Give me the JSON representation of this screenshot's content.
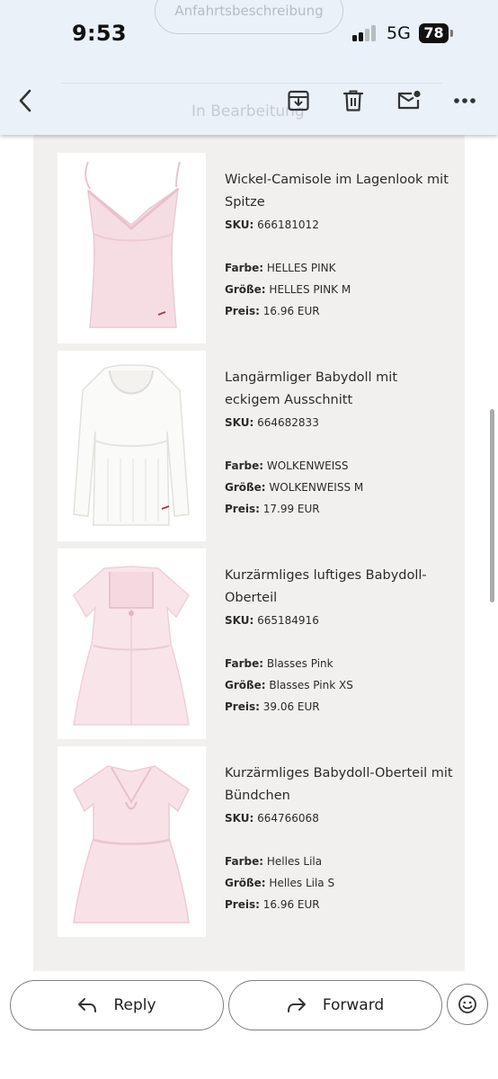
{
  "status_bar": {
    "time": "9:53",
    "network": "5G",
    "battery": "78"
  },
  "faint_overlay": {
    "button_text": "Anfahrtsbeschreibung",
    "order_status": "In Bearbeitung"
  },
  "toolbar": {
    "icons": [
      "back-arrow-icon",
      "archive-icon",
      "trash-icon",
      "mark-unread-icon",
      "more-vert-icon"
    ]
  },
  "labels": {
    "sku": "SKU:",
    "color": "Farbe:",
    "size": "Größe:",
    "price": "Preis:"
  },
  "items": [
    {
      "title": "Wickel-Camisole im Lagenlook mit Spitze",
      "sku": "666181012",
      "color": "HELLES PINK",
      "size": "HELLES PINK M",
      "price": "16.96 EUR",
      "garment_color": "#f6dde4"
    },
    {
      "title": "Langärmliger Babydoll mit eckigem Ausschnitt",
      "sku": "664682833",
      "color": "WOLKENWEISS",
      "size": "WOLKENWEISS M",
      "price": "17.99 EUR",
      "garment_color": "#fafaf8"
    },
    {
      "title": "Kurzärmliges luftiges Babydoll-Oberteil",
      "sku": "665184916",
      "color": "Blasses Pink",
      "size": "Blasses Pink XS",
      "price": "39.06 EUR",
      "garment_color": "#f9e4ea"
    },
    {
      "title": "Kurzärmliges Babydoll-Oberteil mit Bündchen",
      "sku": "664766068",
      "color": "Helles Lila",
      "size": "Helles Lila S",
      "price": "16.96 EUR",
      "garment_color": "#f9e1e8"
    }
  ],
  "bottom_bar": {
    "reply_label": "Reply",
    "forward_label": "Forward"
  }
}
